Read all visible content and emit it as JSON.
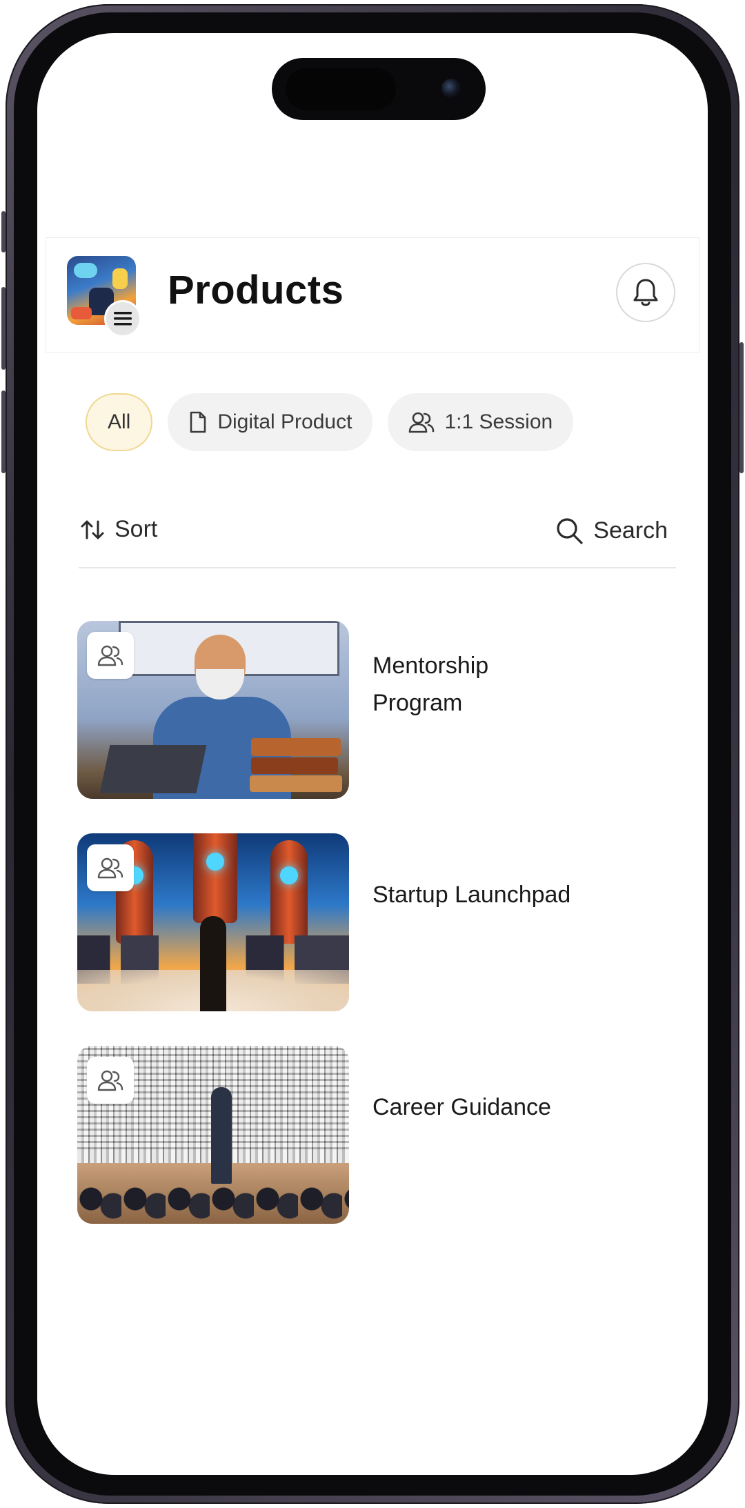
{
  "header": {
    "title": "Products",
    "menu_icon": "hamburger-menu-icon",
    "notification_icon": "bell-icon"
  },
  "filters": {
    "chips": [
      {
        "label": "All",
        "active": true,
        "icon": null
      },
      {
        "label": "Digital Product",
        "active": false,
        "icon": "document-icon"
      },
      {
        "label": "1:1 Session",
        "active": false,
        "icon": "users-icon"
      }
    ]
  },
  "toolbar": {
    "sort_label": "Sort",
    "sort_icon": "sort-arrows-icon",
    "search_label": "Search",
    "search_icon": "search-icon"
  },
  "products": [
    {
      "title": "Mentorship Program",
      "type_icon": "users-icon"
    },
    {
      "title": "Startup Launchpad",
      "type_icon": "users-icon"
    },
    {
      "title": "Career Guidance",
      "type_icon": "users-icon"
    }
  ],
  "colors": {
    "active_chip_bg": "#fdf6e3",
    "active_chip_border": "#f0d890",
    "chip_bg": "#f2f2f2",
    "text_primary": "#111111"
  }
}
